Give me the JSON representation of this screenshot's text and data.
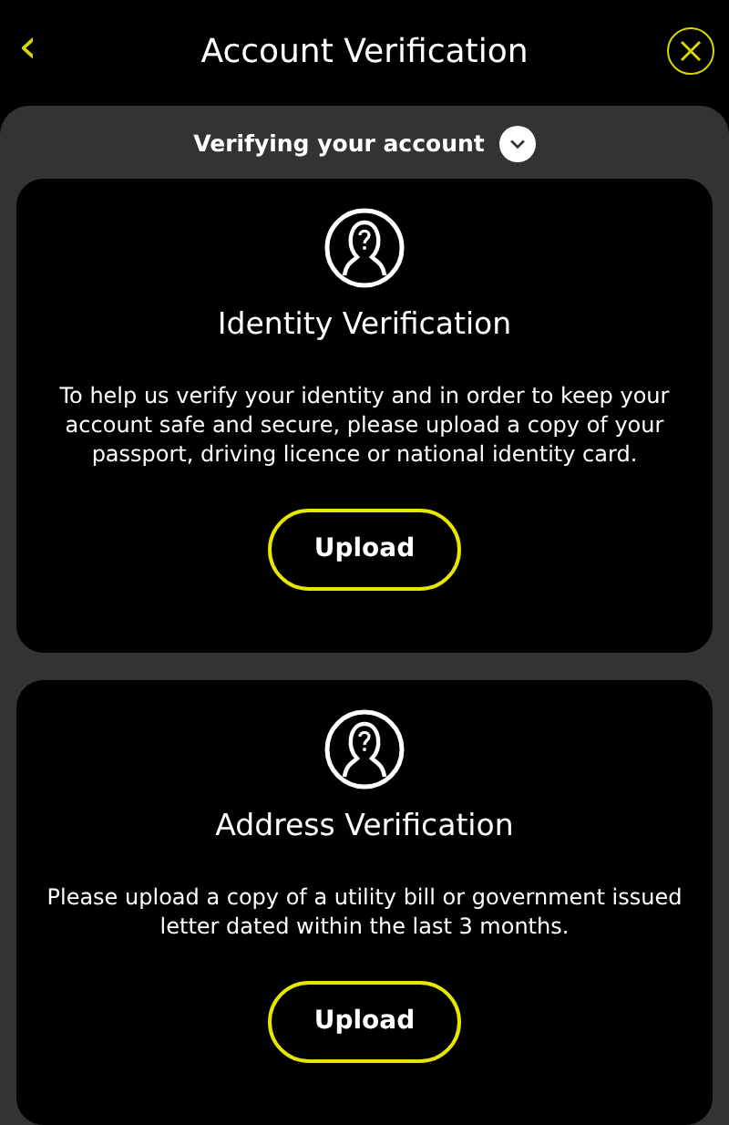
{
  "header": {
    "title": "Account Verification",
    "back_icon": "‹"
  },
  "section": {
    "title": "Verifying your account",
    "expanded": true
  },
  "cards": [
    {
      "title": "Identity Verification",
      "description": "To help us verify your identity and in order to keep your account safe and secure, please upload a copy of your passport, driving licence or national identity card.",
      "button": "Upload"
    },
    {
      "title": "Address Verification",
      "description": "Please upload a copy of a utility bill or government issued letter dated within the last 3 months.",
      "button": "Upload"
    }
  ]
}
